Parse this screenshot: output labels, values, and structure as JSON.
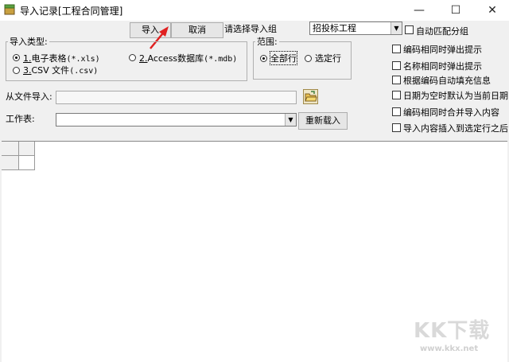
{
  "window": {
    "title": "导入记录[工程合同管理]",
    "minimize_glyph": "—",
    "maximize_glyph": "☐",
    "close_glyph": "✕"
  },
  "toolbar": {
    "import_label": "导入",
    "cancel_label": "取消",
    "group_label": "请选择导入组",
    "group_value": "招投标工程",
    "auto_match_label": "自动匹配分组"
  },
  "import_type": {
    "legend": "导入类型:",
    "options": [
      {
        "key": "1.",
        "label": "电子表格",
        "ext": "(*.xls)",
        "checked": true
      },
      {
        "key": "2.",
        "label": "Access数据库",
        "ext": "(*.mdb)",
        "checked": false
      },
      {
        "key": "3.",
        "label": "CSV 文件",
        "ext": "(.csv)",
        "checked": false
      }
    ]
  },
  "range": {
    "legend": "范围:",
    "options": [
      {
        "label": "全部行",
        "checked": true
      },
      {
        "label": "选定行",
        "checked": false
      }
    ]
  },
  "options_list": [
    {
      "label": "编码相同时弹出提示",
      "checked": false
    },
    {
      "label": "名称相同时弹出提示",
      "checked": false
    },
    {
      "label": "根据编码自动填充信息",
      "checked": false
    },
    {
      "label": "日期为空时默认为当前日期",
      "checked": false
    },
    {
      "label": "编码相同时合并导入内容",
      "checked": false
    },
    {
      "label": "导入内容插入到选定行之后",
      "checked": false
    }
  ],
  "file": {
    "label": "从文件导入:",
    "value": ""
  },
  "sheet": {
    "label": "工作表:",
    "value": "",
    "reload_label": "重新载入"
  },
  "watermark": {
    "text": "KK下载",
    "url": "www.kkx.net"
  },
  "colors": {
    "annotation_arrow": "#e02020"
  }
}
